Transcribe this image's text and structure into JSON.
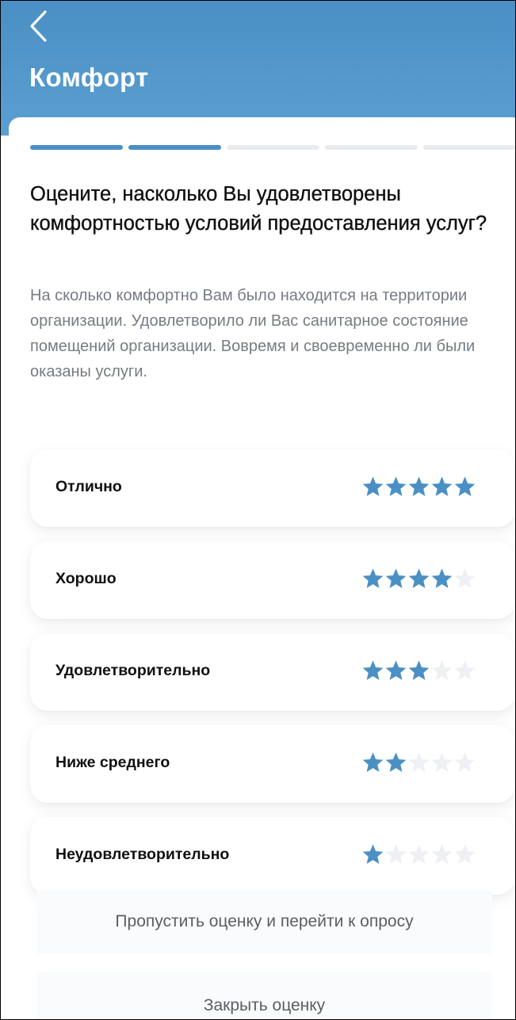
{
  "header": {
    "title": "Комфорт",
    "back_icon": "chevron-left-icon"
  },
  "progress": {
    "total_steps": 5,
    "completed_steps": 2
  },
  "question": {
    "title": "Оцените, насколько Вы удовлетворены комфортностью условий предоставления услуг?",
    "description": "На сколько комфортно Вам было находится на территории организации. Удовлетворило ли Вас санитарное состояние помещений организации. Вовремя и своевременно ли были оказаны услуги."
  },
  "options": [
    {
      "label": "Отлично",
      "rating": 5
    },
    {
      "label": "Хорошо",
      "rating": 4
    },
    {
      "label": "Удовлетворительно",
      "rating": 3
    },
    {
      "label": "Ниже среднего",
      "rating": 2
    },
    {
      "label": "Неудовлетворительно",
      "rating": 1
    }
  ],
  "actions": {
    "skip_label": "Пропустить оценку и перейти к опросу",
    "close_label": "Закрыть оценку"
  },
  "colors": {
    "accent": "#4a90c4",
    "star_filled": "#4a90c4",
    "star_empty": "#eef0f3"
  }
}
